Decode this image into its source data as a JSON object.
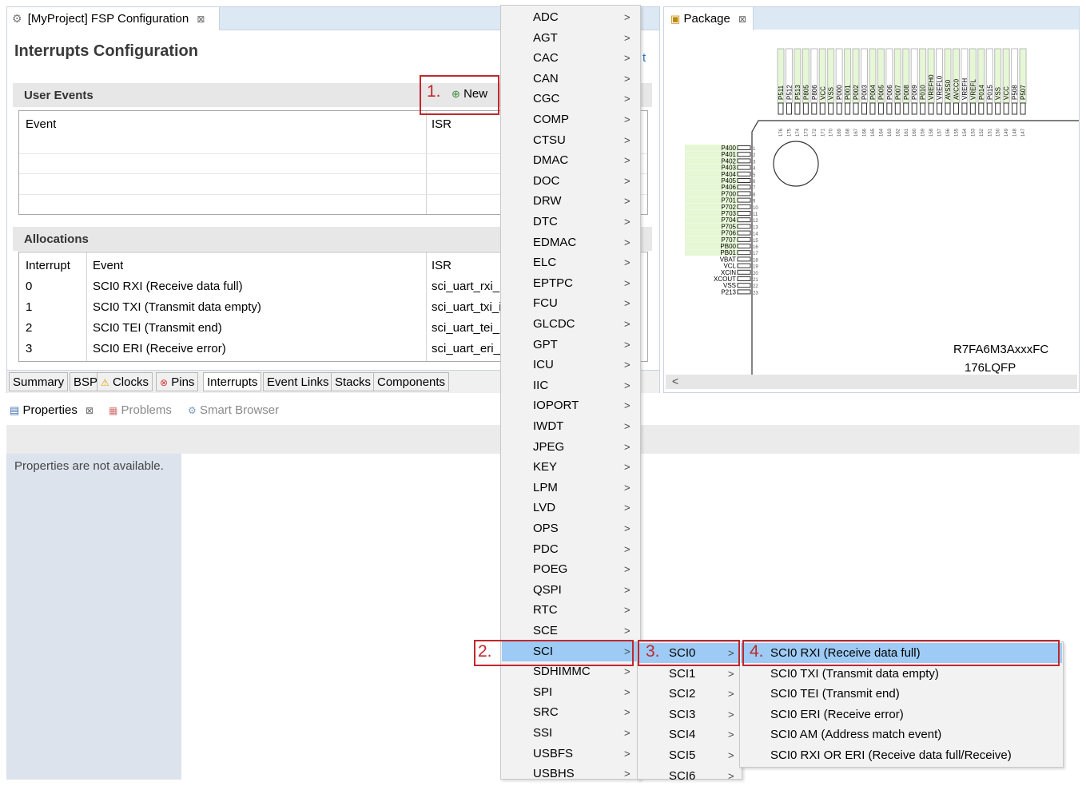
{
  "editor": {
    "tab_title": "[MyProject] FSP Configuration",
    "tab_close": "⊠",
    "page_title": "Interrupts Configuration",
    "partial_link": "t",
    "new_button": "New",
    "user_events": {
      "heading": "User Events",
      "columns": [
        "Event",
        "ISR"
      ]
    },
    "allocations": {
      "heading": "Allocations",
      "columns": [
        "Interrupt",
        "Event",
        "ISR"
      ],
      "rows": [
        {
          "interrupt": "0",
          "event": "SCI0 RXI (Receive data full)",
          "isr": "sci_uart_rxi_isr"
        },
        {
          "interrupt": "1",
          "event": "SCI0 TXI (Transmit data empty)",
          "isr": "sci_uart_txi_isr"
        },
        {
          "interrupt": "2",
          "event": "SCI0 TEI (Transmit end)",
          "isr": "sci_uart_tei_isr"
        },
        {
          "interrupt": "3",
          "event": "SCI0 ERI (Receive error)",
          "isr": "sci_uart_eri_isr"
        }
      ]
    },
    "bottom_tabs": [
      "Summary",
      "BSP",
      "Clocks",
      "Pins",
      "Interrupts",
      "Event Links",
      "Stacks",
      "Components"
    ]
  },
  "package": {
    "tab_title": "Package",
    "chip_name": "R7FA6M3AxxxFC",
    "chip_package": "176LQFP",
    "top_pins": [
      "P511",
      "P512",
      "P513",
      "P805",
      "P806",
      "VCC",
      "VSS",
      "P000",
      "P001",
      "P002",
      "P003",
      "P004",
      "P005",
      "P006",
      "P007",
      "P008",
      "P009",
      "P010",
      "VREFH0",
      "VREFL0",
      "AVSS0",
      "AVCC0",
      "VREFH",
      "VREFL",
      "P014",
      "P015",
      "VSS",
      "VCC",
      "P508",
      "P507"
    ],
    "top_pin_numbers": [
      "176",
      "175",
      "174",
      "173",
      "172",
      "171",
      "170",
      "169",
      "168",
      "167",
      "166",
      "165",
      "164",
      "163",
      "162",
      "161",
      "160",
      "159",
      "158",
      "157",
      "156",
      "155",
      "154",
      "153",
      "152",
      "151",
      "150",
      "149",
      "148",
      "147"
    ],
    "left_pins": [
      "P400",
      "P401",
      "P402",
      "P403",
      "P404",
      "P405",
      "P406",
      "P700",
      "P701",
      "P702",
      "P703",
      "P704",
      "P705",
      "P706",
      "P707",
      "PB00",
      "PB01",
      "VBAT",
      "VCL",
      "XCIN",
      "XCOUT",
      "VSS",
      "P213"
    ],
    "left_pin_numbers": [
      "1",
      "2",
      "3",
      "4",
      "5",
      "6",
      "7",
      "8",
      "9",
      "10",
      "11",
      "12",
      "13",
      "14",
      "15",
      "16",
      "17",
      "18",
      "19",
      "20",
      "21",
      "22",
      "23"
    ],
    "scroll_left": "<"
  },
  "properties": {
    "tabs": [
      "Properties",
      "Problems",
      "Smart Browser"
    ],
    "message": "Properties are not available."
  },
  "peripheral_menu": [
    "ADC",
    "AGT",
    "CAC",
    "CAN",
    "CGC",
    "COMP",
    "CTSU",
    "DMAC",
    "DOC",
    "DRW",
    "DTC",
    "EDMAC",
    "ELC",
    "EPTPC",
    "FCU",
    "GLCDC",
    "GPT",
    "ICU",
    "IIC",
    "IOPORT",
    "IWDT",
    "JPEG",
    "KEY",
    "LPM",
    "LVD",
    "OPS",
    "PDC",
    "POEG",
    "QSPI",
    "RTC",
    "SCE",
    "SCI",
    "SDHIMMC",
    "SPI",
    "SRC",
    "SSI",
    "USBFS",
    "USBHS"
  ],
  "sci_menu": [
    "SCI0",
    "SCI1",
    "SCI2",
    "SCI3",
    "SCI4",
    "SCI5",
    "SCI6"
  ],
  "event_menu": [
    "SCI0 RXI (Receive data full)",
    "SCI0 TXI (Transmit data empty)",
    "SCI0 TEI (Transmit end)",
    "SCI0 ERI (Receive error)",
    "SCI0 AM (Address match event)",
    "SCI0 RXI OR ERI (Receive data full/Receive)"
  ],
  "steps": [
    "1.",
    "2.",
    "3.",
    "4."
  ],
  "chevron": ">",
  "colors": {
    "highlight": "#9ecbf5",
    "step_red": "#c0282d",
    "pin_green": "#e6f7d6",
    "tab_bar": "#dde8f5"
  }
}
